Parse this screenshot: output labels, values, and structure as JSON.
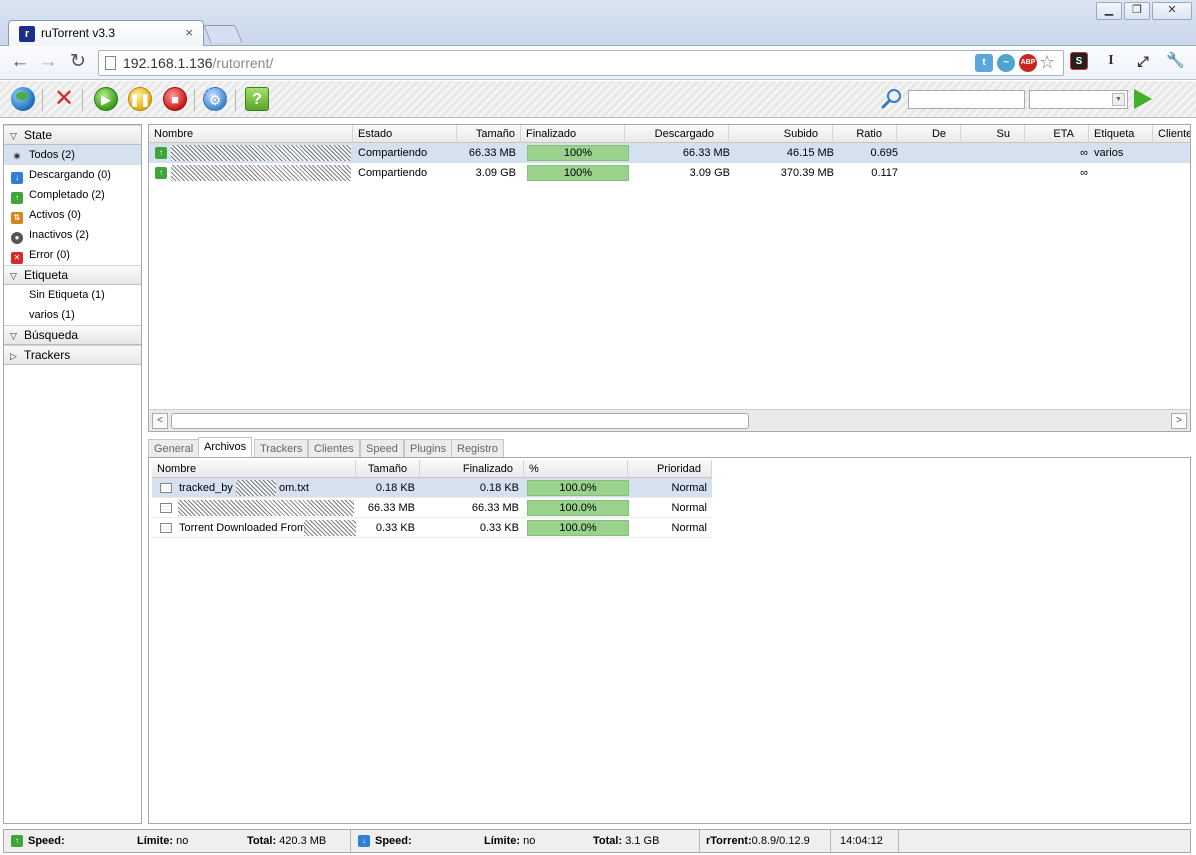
{
  "browser": {
    "tab_title": "ruTorrent v3.3",
    "tab_close": "×",
    "url_host": "192.168.1.136",
    "url_path": "/rutorrent/",
    "window_controls": [
      "minimize-icon",
      "restore-icon",
      "close-icon"
    ]
  },
  "toolbar": {
    "buttons": [
      "add-torrent-icon",
      "remove-icon",
      "start-icon",
      "pause-icon",
      "stop-icon",
      "settings-icon",
      "help-icon"
    ],
    "help_label": "?",
    "search_value": "",
    "search_engine_value": ""
  },
  "sidebar": {
    "state_header": "State",
    "states": [
      {
        "label": "Todos (2)",
        "icon": "all-icon",
        "selected": true
      },
      {
        "label": "Descargando (0)",
        "icon": "download-icon"
      },
      {
        "label": "Completado (2)",
        "icon": "completed-icon"
      },
      {
        "label": "Activos (0)",
        "icon": "active-icon"
      },
      {
        "label": "Inactivos (2)",
        "icon": "inactive-icon"
      },
      {
        "label": "Error (0)",
        "icon": "error-icon"
      }
    ],
    "label_header": "Etiqueta",
    "labels": [
      "Sin Etiqueta (1)",
      "varios (1)"
    ],
    "search_header": "Búsqueda",
    "trackers_header": "Trackers"
  },
  "torrent_list": {
    "columns": [
      "Nombre",
      "Estado",
      "Tamaño",
      "Finalizado",
      "Descargado",
      "Subido",
      "Ratio",
      "De",
      "Su",
      "ETA",
      "Etiqueta",
      "Clientes"
    ],
    "rows": [
      {
        "name": "",
        "status": "Compartiendo",
        "size": "66.33 MB",
        "done": "100%",
        "done_value": 100,
        "downloaded": "66.33 MB",
        "uploaded": "46.15 MB",
        "ratio": "0.695",
        "peers": "",
        "seeds": "",
        "eta": "∞",
        "label": "varios",
        "selected": true
      },
      {
        "name": "",
        "status": "Compartiendo",
        "size": "3.09 GB",
        "done": "100%",
        "done_value": 100,
        "downloaded": "3.09 GB",
        "uploaded": "370.39 MB",
        "ratio": "0.117",
        "peers": "",
        "seeds": "",
        "eta": "∞",
        "label": ""
      }
    ]
  },
  "details": {
    "tabs": [
      "General",
      "Archivos",
      "Trackers",
      "Clientes",
      "Speed",
      "Plugins",
      "Registro"
    ],
    "active_tab": "Archivos",
    "file_columns": [
      "Nombre",
      "Tamaño",
      "Finalizado",
      "%",
      "Prioridad"
    ],
    "files": [
      {
        "name_prefix": "tracked_by",
        "name_suffix": "om.txt",
        "size": "0.18 KB",
        "done": "0.18 KB",
        "pct": "100.0%",
        "pct_value": 100,
        "priority": "Normal",
        "selected": true
      },
      {
        "name_prefix": "",
        "name_suffix": "",
        "size": "66.33 MB",
        "done": "66.33 MB",
        "pct": "100.0%",
        "pct_value": 100,
        "priority": "Normal"
      },
      {
        "name_prefix": "Torrent Downloaded From",
        "name_suffix": "",
        "size": "0.33 KB",
        "done": "0.33 KB",
        "pct": "100.0%",
        "pct_value": 100,
        "priority": "Normal"
      }
    ]
  },
  "status_bar": {
    "up_speed_label": "Speed:",
    "up_limit_label": "Límite:",
    "up_limit_value": "no",
    "up_total_label": "Total:",
    "up_total_value": "420.3 MB",
    "down_speed_label": "Speed:",
    "down_limit_label": "Límite:",
    "down_limit_value": "no",
    "down_total_label": "Total:",
    "down_total_value": "3.1 GB",
    "version_label": "rTorrent:",
    "version_value": "0.8.9/0.12.9",
    "time": "14:04:12"
  },
  "colors": {
    "selection": "#d6e1ef",
    "progress": "#99d28d",
    "seeding_icon": "#3ea637"
  }
}
